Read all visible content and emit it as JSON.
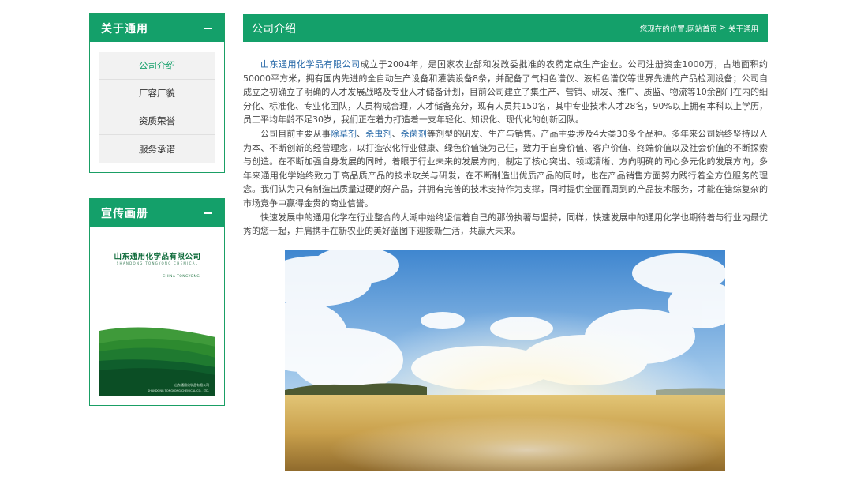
{
  "sidebar": {
    "about": {
      "title": "关于通用",
      "items": [
        {
          "label": "公司介绍",
          "active": true
        },
        {
          "label": "厂容厂貌",
          "active": false
        },
        {
          "label": "资质荣誉",
          "active": false
        },
        {
          "label": "服务承诺",
          "active": false
        }
      ]
    },
    "brochure": {
      "title": "宣传画册",
      "cover": {
        "title": "山东通用化学品有限公司",
        "subtitle": "SHANDONG TONGYONG CHEMICAL",
        "china": "CHINA TONGYONG",
        "footer_cn": "山东通用化学品有限公司",
        "footer_en": "SHANDONG TONGYONG CHEMICAL CO., LTD."
      }
    }
  },
  "main": {
    "title": "公司介绍",
    "breadcrumb": {
      "prefix": "您现在的位置:",
      "home": "网站首页",
      "separator": ">",
      "current": "关于通用"
    },
    "article": {
      "p1": {
        "link": "山东通用化学品有限公司",
        "text": "成立于2004年，是国家农业部和发改委批准的农药定点生产企业。公司注册资金1000万，占地面积约50000平方米，拥有国内先进的全自动生产设备和灌装设备8条，并配备了气相色谱仪、液相色谱仪等世界先进的产品检测设备；公司自成立之初确立了明确的人才发展战略及专业人才储备计划，目前公司建立了集生产、营销、研发、推广、质监、物流等10余部门在内的细分化、标准化、专业化团队，人员构成合理，人才储备充分，现有人员共150名，其中专业技术人才28名，90%以上拥有本科以上学历，员工平均年龄不足30岁，我们正在着力打造着一支年轻化、知识化、现代化的创新团队。"
      },
      "p2": {
        "intro": "公司目前主要从事",
        "link1": "除草剂",
        "sep1": "、",
        "link2": "杀虫剂",
        "sep2": "、",
        "link3": "杀菌剂",
        "text": "等剂型的研发、生产与销售。产品主要涉及4大类30多个品种。多年来公司始终坚持以人为本、不断创新的经营理念，以打造农化行业健康、绿色价值链为己任，致力于自身价值、客户价值、终端价值以及社会价值的不断探索与创造。在不断加强自身发展的同时，着眼于行业未来的发展方向，制定了核心突出、领域清晰、方向明确的同心多元化的发展方向，多年来通用化学始终致力于高品质产品的技术攻关与研发，在不断制造出优质产品的同时，也在产品销售方面努力践行着全方位服务的理念。我们认为只有制造出质量过硬的好产品，并拥有完善的技术支持作为支撑，同时提供全面而周到的产品技术服务，才能在错综复杂的市场竞争中赢得金贵的商业信誉。"
      },
      "p3": {
        "text": "快速发展中的通用化学在行业整合的大潮中始终坚信着自己的那份执著与坚持，同样，快速发展中的通用化学也期待着与行业内最优秀的您一起，并肩携手在新农业的美好蓝图下迎接新生活，共赢大未来。"
      }
    }
  },
  "colors": {
    "brand_green": "#14a06a",
    "link_blue": "#2265a6",
    "menu_bg": "#f2f2f2"
  }
}
